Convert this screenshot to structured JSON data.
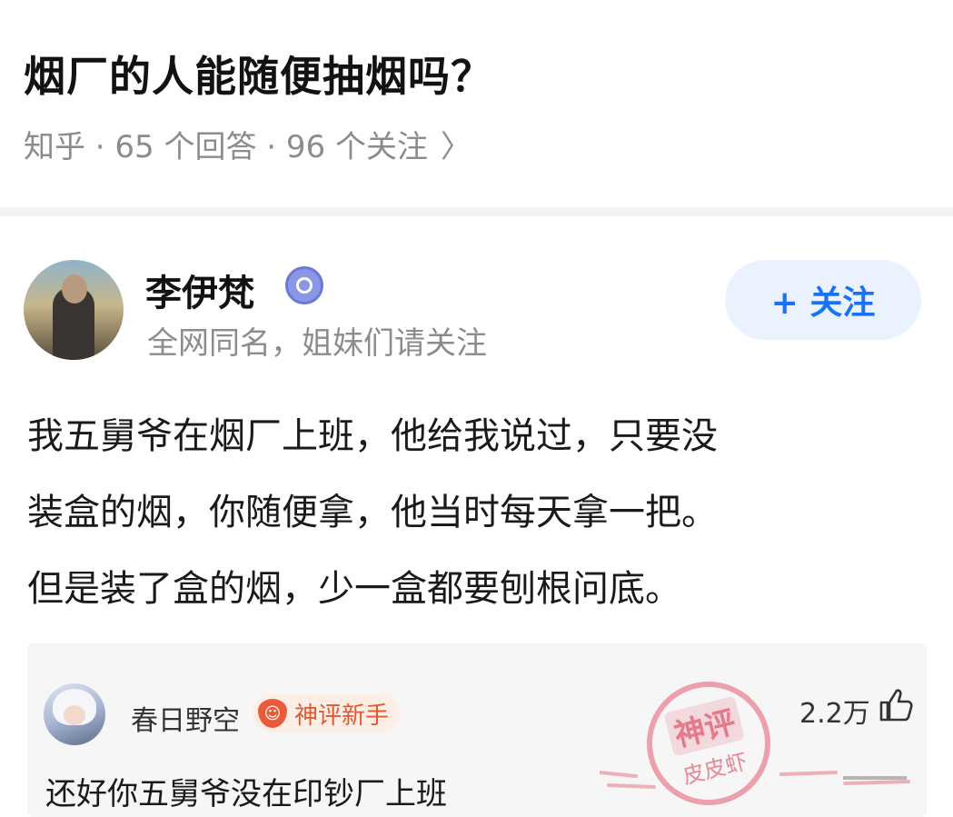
{
  "question": {
    "title": "烟厂的人能随便抽烟吗？",
    "meta": "知乎 · 65 个回答 · 96 个关注",
    "chevron": "〉"
  },
  "answer": {
    "author_name": "李伊梵",
    "author_bio": "全网同名，姐妹们请关注",
    "follow_label": "+ 关注",
    "body_lines": [
      "我五舅爷在烟厂上班，他给我说过，只要没",
      "装盒的烟，你随便拿，他当时每天拿一把。",
      "但是装了盒的烟，少一盒都要刨根问底。"
    ]
  },
  "comment": {
    "user_name": "春日野空",
    "badge_label": "神评新手",
    "likes": "2.2万",
    "text": "还好你五舅爷没在印钞厂上班",
    "stamp_main": "神评",
    "stamp_sub": "皮皮虾"
  },
  "colors": {
    "accent_blue": "#1772f6",
    "follow_bg": "#ebf2ff",
    "badge_orange": "#e4572e",
    "stamp_pink": "#e25a6e"
  }
}
